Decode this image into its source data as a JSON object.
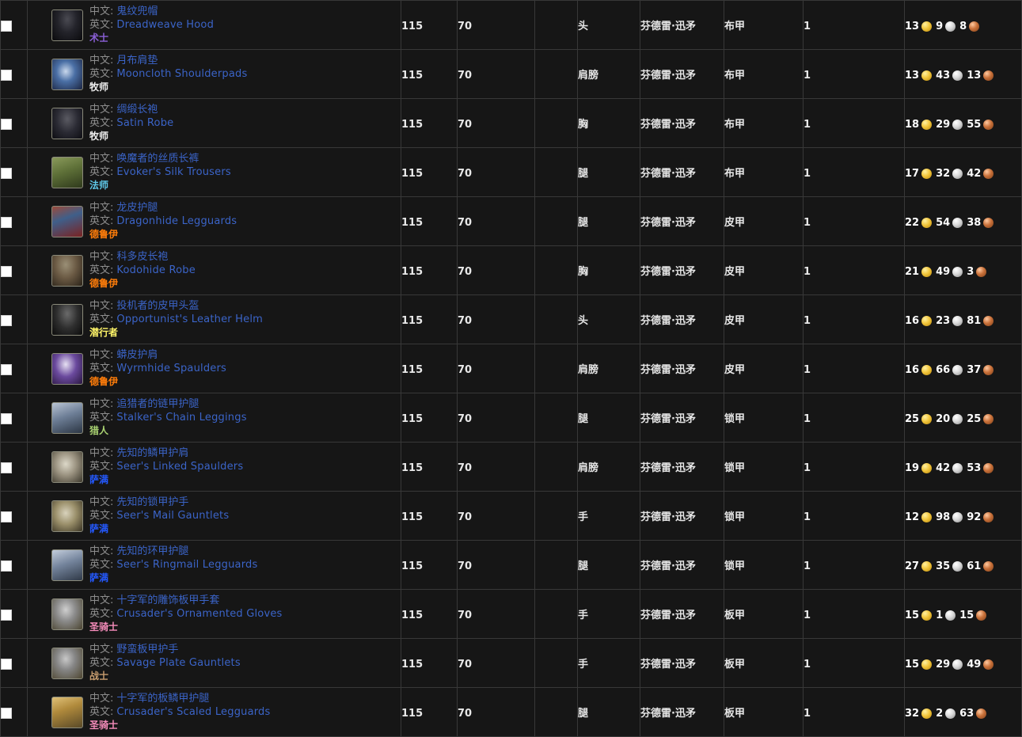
{
  "table": {
    "columns": [
      {
        "key": "check",
        "label": ""
      },
      {
        "key": "name",
        "label": ""
      },
      {
        "key": "ilvl",
        "label": ""
      },
      {
        "key": "req",
        "label": ""
      },
      {
        "key": "blank",
        "label": ""
      },
      {
        "key": "slot",
        "label": ""
      },
      {
        "key": "source",
        "label": ""
      },
      {
        "key": "armor",
        "label": ""
      },
      {
        "key": "qty",
        "label": ""
      },
      {
        "key": "price",
        "label": ""
      }
    ],
    "label_zh": "中文:",
    "label_en": "英文:",
    "class_colors": {
      "术士": "#8a5fd6",
      "牧师": "#f0f0f0",
      "法师": "#5fc8e8",
      "德鲁伊": "#ff7d0a",
      "潜行者": "#fff569",
      "猎人": "#a9d271",
      "萨满": "#2459ff",
      "圣骑士": "#f58cba",
      "战士": "#c79c6e"
    },
    "rows": [
      {
        "zh": "鬼纹兜帽",
        "en": "Dreadweave Hood",
        "cls": "术士",
        "ilvl": "115",
        "req": "70",
        "blank": "",
        "slot": "头",
        "source": "芬德雷·迅矛",
        "armor": "布甲",
        "qty": "1",
        "gold": "13",
        "silver": "9",
        "copper": "8",
        "icon": "hood-dark"
      },
      {
        "zh": "月布肩垫",
        "en": "Mooncloth Shoulderpads",
        "cls": "牧师",
        "ilvl": "115",
        "req": "70",
        "blank": "",
        "slot": "肩膀",
        "source": "芬德雷·迅矛",
        "armor": "布甲",
        "qty": "1",
        "gold": "13",
        "silver": "43",
        "copper": "13",
        "icon": "shoulder-blue"
      },
      {
        "zh": "绸缎长袍",
        "en": "Satin Robe",
        "cls": "牧师",
        "ilvl": "115",
        "req": "70",
        "blank": "",
        "slot": "胸",
        "source": "芬德雷·迅矛",
        "armor": "布甲",
        "qty": "1",
        "gold": "18",
        "silver": "29",
        "copper": "55",
        "icon": "robe-dark"
      },
      {
        "zh": "唤魔者的丝质长裤",
        "en": "Evoker's Silk Trousers",
        "cls": "法师",
        "ilvl": "115",
        "req": "70",
        "blank": "",
        "slot": "腿",
        "source": "芬德雷·迅矛",
        "armor": "布甲",
        "qty": "1",
        "gold": "17",
        "silver": "32",
        "copper": "42",
        "icon": "pants-green"
      },
      {
        "zh": "龙皮护腿",
        "en": "Dragonhide Legguards",
        "cls": "德鲁伊",
        "ilvl": "115",
        "req": "70",
        "blank": "",
        "slot": "腿",
        "source": "芬德雷·迅矛",
        "armor": "皮甲",
        "qty": "1",
        "gold": "22",
        "silver": "54",
        "copper": "38",
        "icon": "pants-red"
      },
      {
        "zh": "科多皮长袍",
        "en": "Kodohide Robe",
        "cls": "德鲁伊",
        "ilvl": "115",
        "req": "70",
        "blank": "",
        "slot": "胸",
        "source": "芬德雷·迅矛",
        "armor": "皮甲",
        "qty": "1",
        "gold": "21",
        "silver": "49",
        "copper": "3",
        "icon": "robe-brown"
      },
      {
        "zh": "投机者的皮甲头盔",
        "en": "Opportunist's Leather Helm",
        "cls": "潜行者",
        "ilvl": "115",
        "req": "70",
        "blank": "",
        "slot": "头",
        "source": "芬德雷·迅矛",
        "armor": "皮甲",
        "qty": "1",
        "gold": "16",
        "silver": "23",
        "copper": "81",
        "icon": "hood-grey"
      },
      {
        "zh": "蟒皮护肩",
        "en": "Wyrmhide Spaulders",
        "cls": "德鲁伊",
        "ilvl": "115",
        "req": "70",
        "blank": "",
        "slot": "肩膀",
        "source": "芬德雷·迅矛",
        "armor": "皮甲",
        "qty": "1",
        "gold": "16",
        "silver": "66",
        "copper": "37",
        "icon": "shoulder-purple"
      },
      {
        "zh": "追猎者的链甲护腿",
        "en": "Stalker's Chain Leggings",
        "cls": "猎人",
        "ilvl": "115",
        "req": "70",
        "blank": "",
        "slot": "腿",
        "source": "芬德雷·迅矛",
        "armor": "锁甲",
        "qty": "1",
        "gold": "25",
        "silver": "20",
        "copper": "25",
        "icon": "pants-mail"
      },
      {
        "zh": "先知的鳞甲护肩",
        "en": "Seer's Linked Spaulders",
        "cls": "萨满",
        "ilvl": "115",
        "req": "70",
        "blank": "",
        "slot": "肩膀",
        "source": "芬德雷·迅矛",
        "armor": "锁甲",
        "qty": "1",
        "gold": "19",
        "silver": "42",
        "copper": "53",
        "icon": "shoulder-mail"
      },
      {
        "zh": "先知的锁甲护手",
        "en": "Seer's Mail Gauntlets",
        "cls": "萨满",
        "ilvl": "115",
        "req": "70",
        "blank": "",
        "slot": "手",
        "source": "芬德雷·迅矛",
        "armor": "锁甲",
        "qty": "1",
        "gold": "12",
        "silver": "98",
        "copper": "92",
        "icon": "glove-mail"
      },
      {
        "zh": "先知的环甲护腿",
        "en": "Seer's Ringmail Legguards",
        "cls": "萨满",
        "ilvl": "115",
        "req": "70",
        "blank": "",
        "slot": "腿",
        "source": "芬德雷·迅矛",
        "armor": "锁甲",
        "qty": "1",
        "gold": "27",
        "silver": "35",
        "copper": "61",
        "icon": "pants-mail2"
      },
      {
        "zh": "十字军的雕饰板甲手套",
        "en": "Crusader's Ornamented Gloves",
        "cls": "圣骑士",
        "ilvl": "115",
        "req": "70",
        "blank": "",
        "slot": "手",
        "source": "芬德雷·迅矛",
        "armor": "板甲",
        "qty": "1",
        "gold": "15",
        "silver": "1",
        "copper": "15",
        "icon": "glove-plate"
      },
      {
        "zh": "野蛮板甲护手",
        "en": "Savage Plate Gauntlets",
        "cls": "战士",
        "ilvl": "115",
        "req": "70",
        "blank": "",
        "slot": "手",
        "source": "芬德雷·迅矛",
        "armor": "板甲",
        "qty": "1",
        "gold": "15",
        "silver": "29",
        "copper": "49",
        "icon": "glove-plate2"
      },
      {
        "zh": "十字军的板鳞甲护腿",
        "en": "Crusader's Scaled Legguards",
        "cls": "圣骑士",
        "ilvl": "115",
        "req": "70",
        "blank": "",
        "slot": "腿",
        "source": "芬德雷·迅矛",
        "armor": "板甲",
        "qty": "1",
        "gold": "32",
        "silver": "2",
        "copper": "63",
        "icon": "pants-gold"
      }
    ]
  }
}
